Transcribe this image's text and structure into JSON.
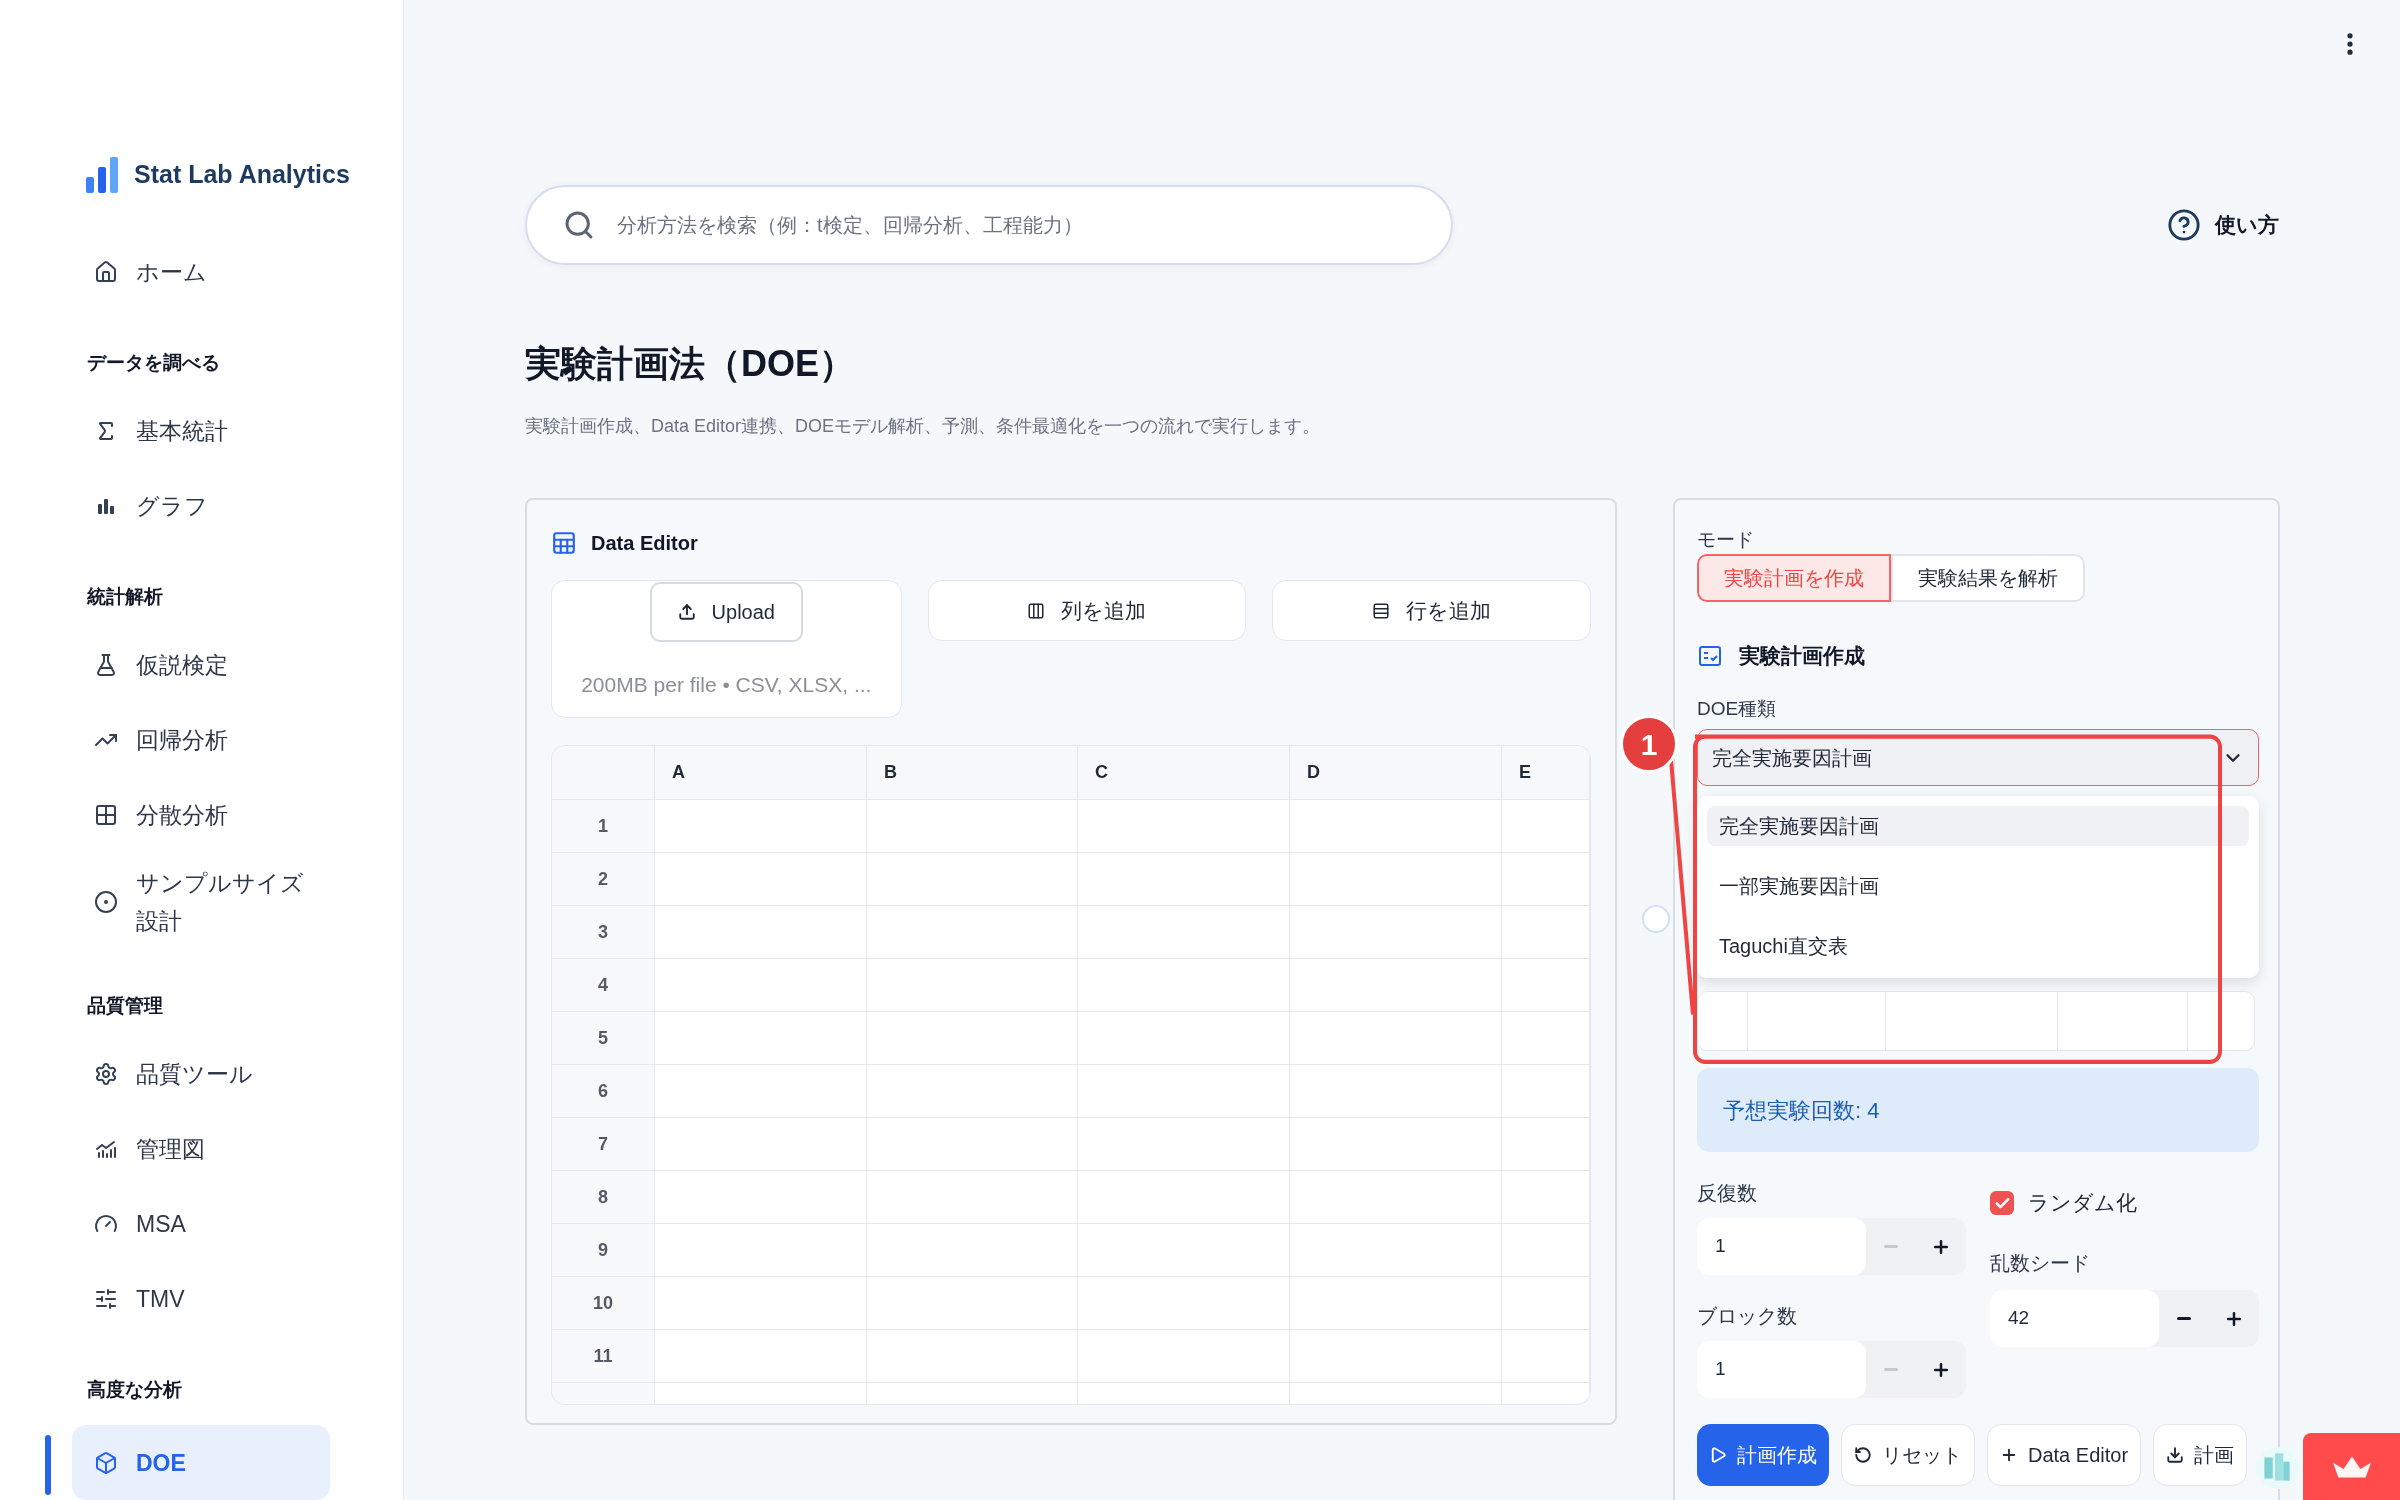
{
  "sidebar": {
    "brand": "Stat Lab Analytics",
    "sections": [
      {
        "items": [
          {
            "label": "ホーム",
            "kind": "home",
            "selected": false
          }
        ]
      },
      {
        "heading": "データを調べる",
        "items": [
          {
            "label": "基本統計",
            "kind": "sigma",
            "selected": false
          },
          {
            "label": "グラフ",
            "kind": "bars",
            "selected": false
          }
        ]
      },
      {
        "heading": "統計解析",
        "items": [
          {
            "label": "仮説検定",
            "kind": "flask",
            "selected": false
          },
          {
            "label": "回帰分析",
            "kind": "trend",
            "selected": false
          },
          {
            "label": "分散分析",
            "kind": "grid",
            "selected": false
          },
          {
            "label": "サンプルサイズ設計",
            "kind": "target",
            "selected": false
          }
        ]
      },
      {
        "heading": "品質管理",
        "items": [
          {
            "label": "品質ツール",
            "kind": "gear",
            "selected": false
          },
          {
            "label": "管理図",
            "kind": "chart",
            "selected": false
          },
          {
            "label": "MSA",
            "kind": "gauge",
            "selected": false
          },
          {
            "label": "TMV",
            "kind": "sliders",
            "selected": false
          }
        ]
      },
      {
        "heading": "高度な分析",
        "items": [
          {
            "label": "DOE",
            "kind": "cube",
            "selected": true
          }
        ]
      }
    ]
  },
  "header": {
    "search": {
      "placeholder": "分析方法を検索（例：t検定、回帰分析、工程能力）"
    },
    "help": "使い方"
  },
  "page": {
    "title": "実験計画法（DOE）",
    "subtitle": "実験計画作成、Data Editor連携、DOEモデル解析、予測、条件最適化を一つの流れで実行します。"
  },
  "data_editor": {
    "title": "Data Editor",
    "upload_button": "Upload",
    "upload_hint": "200MB per file • CSV, XLSX, ...",
    "buttons": [
      {
        "label": "列を追加",
        "kind": "columns"
      },
      {
        "label": "行を追加",
        "kind": "rows"
      }
    ],
    "columns": [
      "A",
      "B",
      "C",
      "D",
      "E"
    ],
    "row_numbers": [
      "1",
      "2",
      "3",
      "4",
      "5",
      "6",
      "7",
      "8",
      "9",
      "10",
      "11"
    ]
  },
  "design_panel": {
    "mode_label": "モード",
    "modes": [
      {
        "label": "実験計画を作成",
        "selected": true
      },
      {
        "label": "実験結果を解析",
        "selected": false
      }
    ],
    "section_title": "実験計画作成",
    "doe_type": {
      "label": "DOE種類",
      "value": "完全実施要因計画",
      "expanded": true,
      "options": [
        {
          "label": "完全実施要因計画",
          "selected": true
        },
        {
          "label": "一部実施要因計画",
          "selected": false
        },
        {
          "label": "Taguchi直交表",
          "selected": false
        }
      ]
    },
    "annotation": {
      "label": "1"
    },
    "estimate": "予想実験回数: 4",
    "replicates": {
      "label": "反復数",
      "value": "1",
      "decrement_disabled": true
    },
    "blocks": {
      "label": "ブロック数",
      "value": "1",
      "decrement_disabled": true
    },
    "randomize": {
      "label": "ランダム化",
      "checked": true
    },
    "seed": {
      "label": "乱数シード",
      "value": "42",
      "decrement_disabled": false
    },
    "actions": [
      {
        "label": "計画作成",
        "kind": "play",
        "primary": true
      },
      {
        "label": "リセット",
        "kind": "reset",
        "primary": false
      },
      {
        "label": "Data Editor",
        "kind": "plus",
        "primary": false
      },
      {
        "label": "計画",
        "kind": "download",
        "primary": false
      }
    ]
  }
}
